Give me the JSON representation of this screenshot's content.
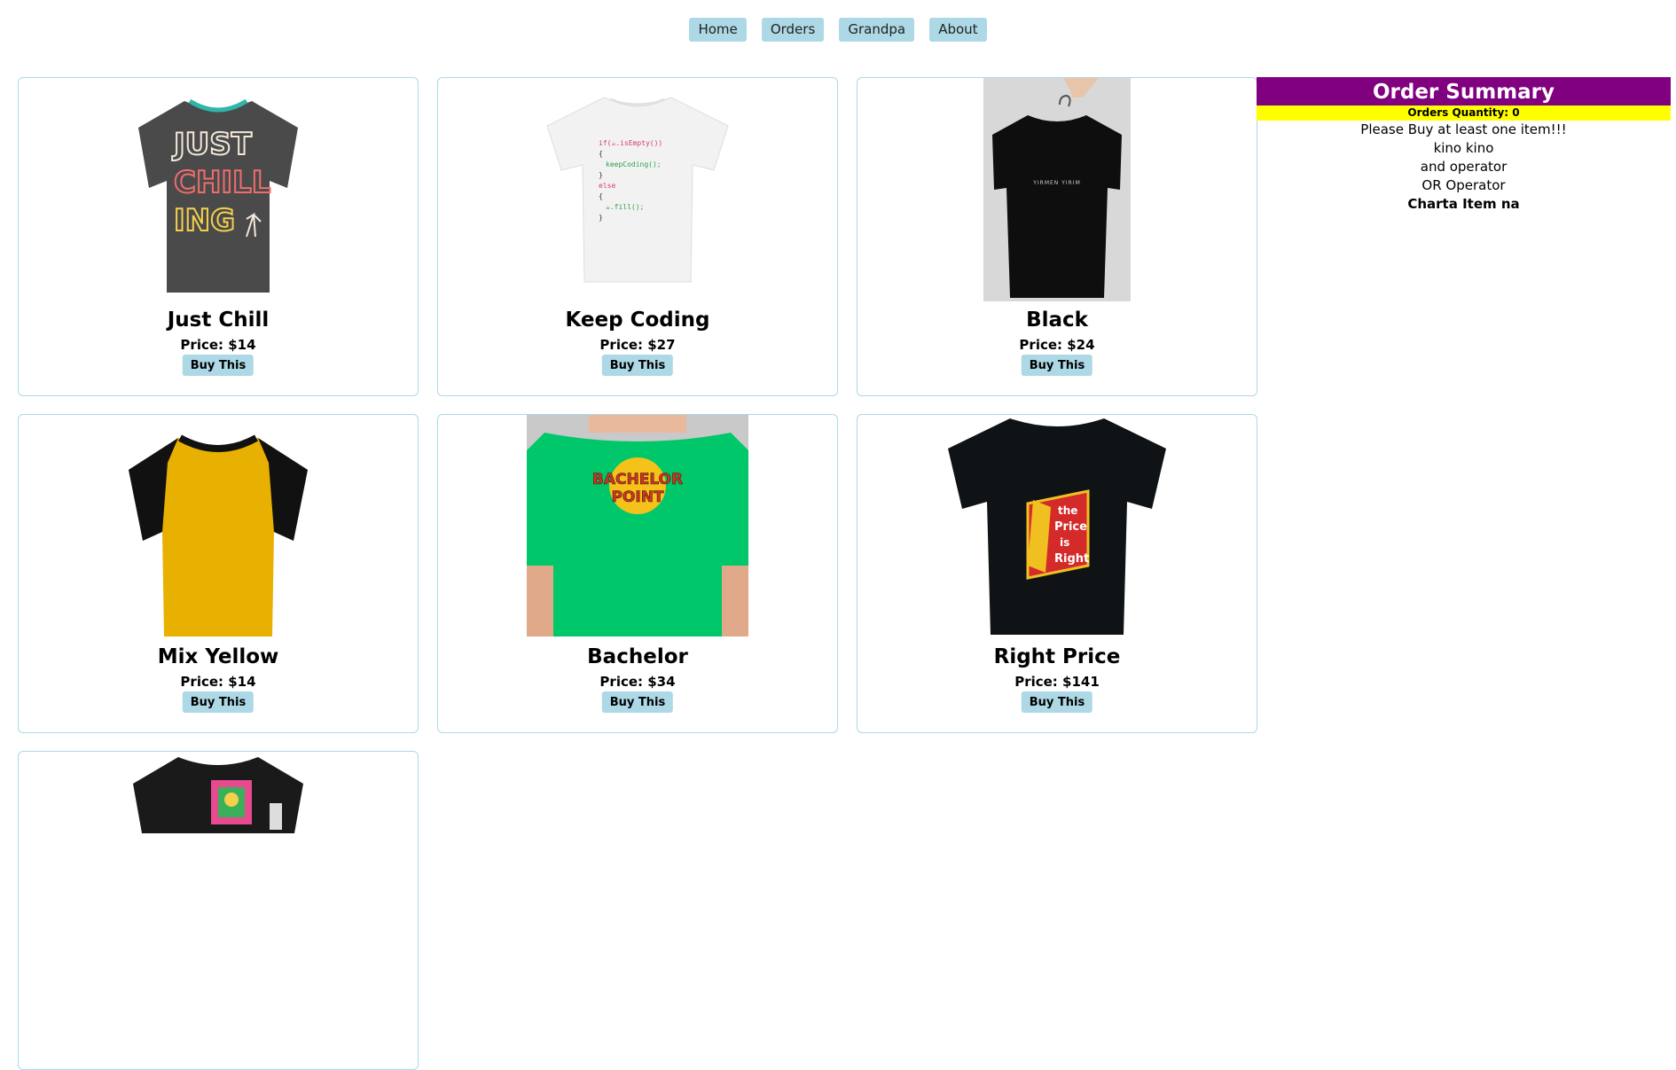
{
  "nav": {
    "items": [
      {
        "label": "Home"
      },
      {
        "label": "Orders"
      },
      {
        "label": "Grandpa"
      },
      {
        "label": "About"
      }
    ]
  },
  "products": [
    {
      "name": "Just Chill",
      "price": "Price: $14",
      "buy": "Buy This",
      "shirt_color": "#4a4a4a",
      "image_text": [
        "JUST",
        "CHILL",
        "ING"
      ]
    },
    {
      "name": "Keep Coding",
      "price": "Price: $27",
      "buy": "Buy This",
      "shirt_color": "#f2f2f2",
      "image_text": [
        "if(☕.isEmpty())",
        "{",
        "keepCoding();",
        "}",
        "else",
        "{",
        "☕.fill();",
        "}"
      ]
    },
    {
      "name": "Black",
      "price": "Price: $24",
      "buy": "Buy This",
      "shirt_color": "#0e0e0e",
      "image_text": [
        "YIRMEN YIRIM"
      ]
    },
    {
      "name": "Mix Yellow",
      "price": "Price: $14",
      "buy": "Buy This",
      "shirt_color": "#e8b000"
    },
    {
      "name": "Bachelor",
      "price": "Price: $34",
      "buy": "Buy This",
      "shirt_color": "#00c86a",
      "image_text": [
        "BACHELOR",
        "POINT"
      ]
    },
    {
      "name": "Right Price",
      "price": "Price: $141",
      "buy": "Buy This",
      "shirt_color": "#0f1316",
      "image_text": [
        "the",
        "Price",
        "is",
        "Right"
      ]
    },
    {
      "shirt_color": "#1a1a1a"
    }
  ],
  "summary": {
    "title": "Order Summary",
    "quantity": "Orders Quantity: 0",
    "lines": [
      "Please Buy at least one item!!!",
      "kino kino",
      "and operator",
      "OR Operator"
    ],
    "bold_line": "Charta Item na"
  }
}
